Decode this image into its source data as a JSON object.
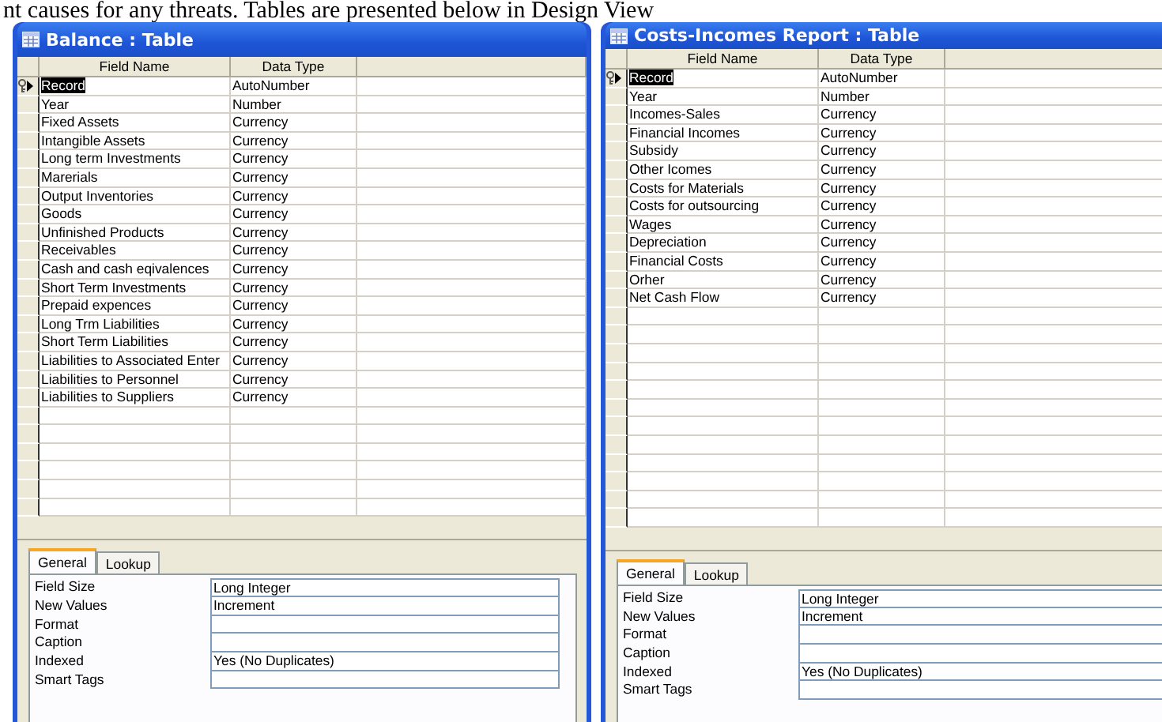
{
  "caption": "nt causes for any threats. Tables are presented below in Design View",
  "windows": [
    {
      "title": "Balance : Table",
      "columns": [
        "Field Name",
        "Data Type"
      ],
      "rows": [
        {
          "field_name": "Record",
          "data_type": "AutoNumber",
          "primary_key": true,
          "selected": true
        },
        {
          "field_name": "Year",
          "data_type": "Number",
          "primary_key": false,
          "selected": false
        },
        {
          "field_name": "Fixed  Assets",
          "data_type": "Currency",
          "primary_key": false,
          "selected": false
        },
        {
          "field_name": "Intangible Assets",
          "data_type": "Currency",
          "primary_key": false,
          "selected": false
        },
        {
          "field_name": "Long term Investments",
          "data_type": "Currency",
          "primary_key": false,
          "selected": false
        },
        {
          "field_name": "Marerials",
          "data_type": "Currency",
          "primary_key": false,
          "selected": false
        },
        {
          "field_name": "Output Inventories",
          "data_type": "Currency",
          "primary_key": false,
          "selected": false
        },
        {
          "field_name": "Goods",
          "data_type": "Currency",
          "primary_key": false,
          "selected": false
        },
        {
          "field_name": "Unfinished Products",
          "data_type": "Currency",
          "primary_key": false,
          "selected": false
        },
        {
          "field_name": "Receivables",
          "data_type": "Currency",
          "primary_key": false,
          "selected": false
        },
        {
          "field_name": "Cash and cash eqivalences",
          "data_type": "Currency",
          "primary_key": false,
          "selected": false
        },
        {
          "field_name": "Short Term Investments",
          "data_type": "Currency",
          "primary_key": false,
          "selected": false
        },
        {
          "field_name": "Prepaid expences",
          "data_type": "Currency",
          "primary_key": false,
          "selected": false
        },
        {
          "field_name": "Long Trm Liabilities",
          "data_type": "Currency",
          "primary_key": false,
          "selected": false
        },
        {
          "field_name": "Short Term Liabilities",
          "data_type": "Currency",
          "primary_key": false,
          "selected": false
        },
        {
          "field_name": "Liabilities to Associated Enter",
          "data_type": "Currency",
          "primary_key": false,
          "selected": false
        },
        {
          "field_name": "Liabilities to Personnel",
          "data_type": "Currency",
          "primary_key": false,
          "selected": false
        },
        {
          "field_name": "Liabilities to Suppliers",
          "data_type": "Currency",
          "primary_key": false,
          "selected": false
        }
      ],
      "tabs": [
        {
          "label": "General",
          "selected": true
        },
        {
          "label": "Lookup",
          "selected": false
        }
      ],
      "properties": [
        {
          "label": "Field Size",
          "value": "Long Integer"
        },
        {
          "label": "New Values",
          "value": "Increment"
        },
        {
          "label": "Format"
        },
        {
          "label": "Caption"
        },
        {
          "label": "Indexed",
          "value": "Yes (No Duplicates)"
        },
        {
          "label": "Smart Tags"
        }
      ]
    },
    {
      "title": "Costs-Incomes Report : Table",
      "columns": [
        "Field Name",
        "Data Type"
      ],
      "rows": [
        {
          "field_name": "Record",
          "data_type": "AutoNumber",
          "primary_key": true,
          "selected": true
        },
        {
          "field_name": "Year",
          "data_type": "Number",
          "primary_key": false,
          "selected": false
        },
        {
          "field_name": "Incomes-Sales",
          "data_type": "Currency",
          "primary_key": false,
          "selected": false
        },
        {
          "field_name": "Financial Incomes",
          "data_type": "Currency",
          "primary_key": false,
          "selected": false
        },
        {
          "field_name": "Subsidy",
          "data_type": "Currency",
          "primary_key": false,
          "selected": false
        },
        {
          "field_name": "Other Icomes",
          "data_type": "Currency",
          "primary_key": false,
          "selected": false
        },
        {
          "field_name": "Costs for Materials",
          "data_type": "Currency",
          "primary_key": false,
          "selected": false
        },
        {
          "field_name": "Costs for outsourcing",
          "data_type": "Currency",
          "primary_key": false,
          "selected": false
        },
        {
          "field_name": "Wages",
          "data_type": "Currency",
          "primary_key": false,
          "selected": false
        },
        {
          "field_name": "Depreciation",
          "data_type": "Currency",
          "primary_key": false,
          "selected": false
        },
        {
          "field_name": "Financial Costs",
          "data_type": "Currency",
          "primary_key": false,
          "selected": false
        },
        {
          "field_name": "Orher",
          "data_type": "Currency",
          "primary_key": false,
          "selected": false
        },
        {
          "field_name": "Net Cash Flow",
          "data_type": "Currency",
          "primary_key": false,
          "selected": false
        }
      ],
      "tabs": [
        {
          "label": "General",
          "selected": true
        },
        {
          "label": "Lookup",
          "selected": false
        }
      ],
      "properties": [
        {
          "label": "Field Size",
          "value": "Long Integer"
        },
        {
          "label": "New Values",
          "value": "Increment"
        },
        {
          "label": "Format"
        },
        {
          "label": "Caption"
        },
        {
          "label": "Indexed",
          "value": "Yes (No Duplicates)"
        },
        {
          "label": "Smart Tags"
        }
      ]
    }
  ]
}
